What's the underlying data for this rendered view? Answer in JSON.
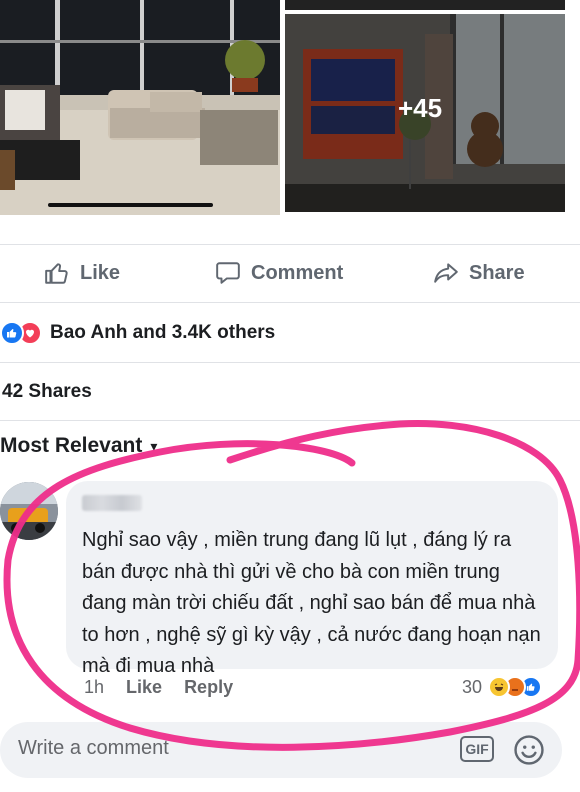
{
  "post": {
    "photos": {
      "more_count": "+45"
    },
    "actions": {
      "like_label": "Like",
      "comment_label": "Comment",
      "share_label": "Share"
    },
    "reactions": {
      "summary": "Bao Anh and 3.4K others",
      "types": [
        "like",
        "love"
      ]
    },
    "shares": "42 Shares",
    "sort_label": "Most Relevant"
  },
  "comment": {
    "author": "",
    "text": "Nghỉ sao vậy , miền trung đang lũ lụt , đáng lý ra bán được nhà thì gửi về cho bà con miền trung đang màn trời chiếu đất , nghỉ sao bán để mua nhà to hơn , nghệ sỹ gì kỳ vậy , cả nước đang hoạn nạn mà đi mua nhà",
    "time": "1h",
    "like_label": "Like",
    "reply_label": "Reply",
    "reaction_count": "30",
    "reaction_types": [
      "haha",
      "angry",
      "like"
    ]
  },
  "composer": {
    "placeholder": "Write a comment",
    "gif_label": "GIF"
  },
  "colors": {
    "accent": "#1877f2",
    "love": "#f33e58",
    "annotation": "#ee2d8a"
  },
  "icons": {
    "like": "thumbs-up-icon",
    "comment": "speech-bubble-icon",
    "share": "share-arrow-icon",
    "emoji": "smiley-icon"
  }
}
